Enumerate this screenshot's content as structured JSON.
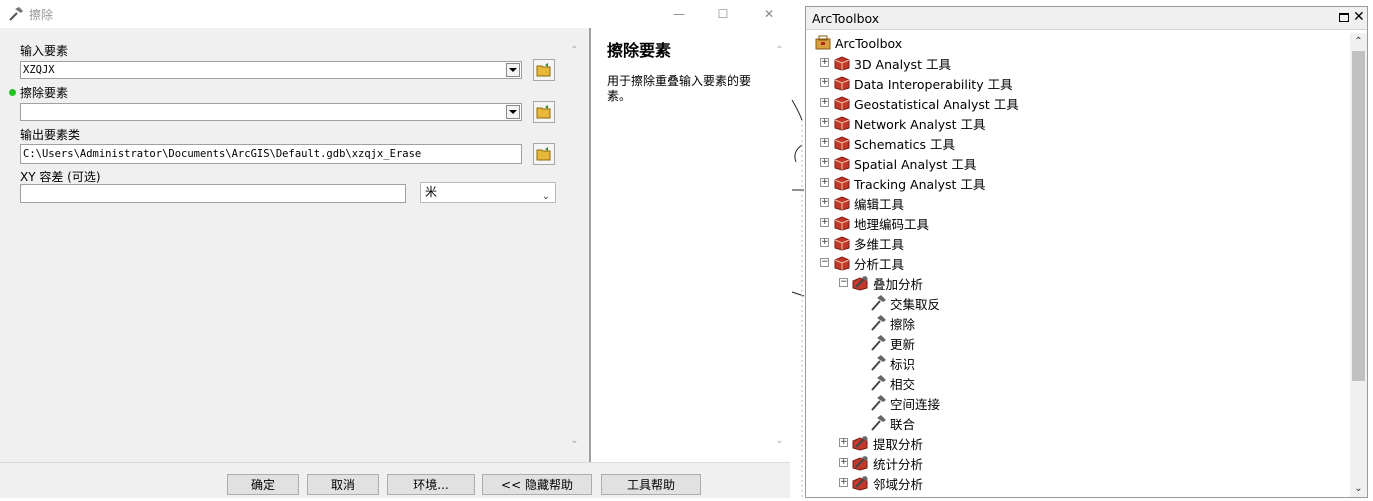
{
  "dialog": {
    "title": "擦除",
    "controls": {
      "minimize": "—",
      "maximize": "☐",
      "close": "✕"
    },
    "params": {
      "input_label": "输入要素",
      "input_value": "XZQJX",
      "erase_label": "擦除要素",
      "erase_value": "",
      "output_label": "输出要素类",
      "output_value": "C:\\Users\\Administrator\\Documents\\ArcGIS\\Default.gdb\\xzqjx_Erase",
      "xy_label": "XY 容差 (可选)",
      "xy_value": "",
      "xy_unit": "米"
    },
    "help": {
      "title": "擦除要素",
      "text": "用于擦除重叠输入要素的要素。"
    },
    "buttons": {
      "ok": "确定",
      "cancel": "取消",
      "env": "环境...",
      "hide_help": "<< 隐藏帮助",
      "tool_help": "工具帮助"
    }
  },
  "toolbox": {
    "title": "ArcToolbox",
    "items": [
      {
        "label": "ArcToolbox",
        "type": "root"
      },
      {
        "label": "3D Analyst 工具",
        "type": "box"
      },
      {
        "label": "Data Interoperability 工具",
        "type": "box"
      },
      {
        "label": "Geostatistical Analyst 工具",
        "type": "box"
      },
      {
        "label": "Network Analyst 工具",
        "type": "box"
      },
      {
        "label": "Schematics 工具",
        "type": "box"
      },
      {
        "label": "Spatial Analyst 工具",
        "type": "box"
      },
      {
        "label": "Tracking Analyst 工具",
        "type": "box"
      },
      {
        "label": "编辑工具",
        "type": "box"
      },
      {
        "label": "地理编码工具",
        "type": "box"
      },
      {
        "label": "多维工具",
        "type": "box"
      },
      {
        "label": "分析工具",
        "type": "box"
      },
      {
        "label": "叠加分析",
        "type": "toolset"
      },
      {
        "label": "交集取反",
        "type": "tool"
      },
      {
        "label": "擦除",
        "type": "tool"
      },
      {
        "label": "更新",
        "type": "tool"
      },
      {
        "label": "标识",
        "type": "tool"
      },
      {
        "label": "相交",
        "type": "tool"
      },
      {
        "label": "空间连接",
        "type": "tool"
      },
      {
        "label": "联合",
        "type": "tool"
      },
      {
        "label": "提取分析",
        "type": "toolset"
      },
      {
        "label": "统计分析",
        "type": "toolset"
      },
      {
        "label": "邻域分析",
        "type": "toolset"
      }
    ]
  },
  "colors": {
    "required_dot": "#22c322",
    "toolbox_red": "#c0392b",
    "folder_yellow": "#e8b83a"
  }
}
